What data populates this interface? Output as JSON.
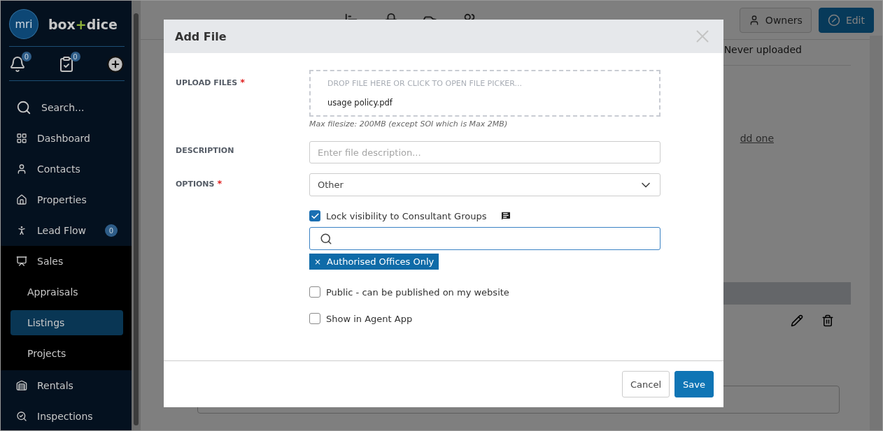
{
  "sidebar": {
    "logo_badge": "mri",
    "logo_parts": [
      "box",
      "+",
      "dice"
    ],
    "counters": [
      {
        "count": "0"
      },
      {
        "count": "0"
      }
    ],
    "items": [
      {
        "label": "Search...",
        "selected": false
      },
      {
        "label": "Dashboard",
        "selected": false
      },
      {
        "label": "Contacts",
        "selected": false
      },
      {
        "label": "Properties",
        "selected": false
      },
      {
        "label": "Lead Flow",
        "badge": "0",
        "selected": false
      },
      {
        "label": "Sales",
        "selected": false,
        "expanded": true,
        "children": [
          {
            "label": "Appraisals",
            "selected": false
          },
          {
            "label": "Listings",
            "selected": true
          },
          {
            "label": "Projects",
            "selected": false
          }
        ]
      },
      {
        "label": "Rentals",
        "selected": false
      },
      {
        "label": "Inspections",
        "selected": false
      }
    ]
  },
  "header": {
    "buttons": [
      {
        "label": "Owners"
      },
      {
        "label": "Edit"
      }
    ]
  },
  "background": {
    "upload_status": "Never uploaded",
    "link": "dd one"
  },
  "dialog": {
    "title": "Add File",
    "upload": {
      "label": "UPLOAD FILES",
      "required_mark": "*",
      "hint": "DROP FILE HERE OR CLICK TO OPEN FILE PICKER...",
      "file": "usage policy.pdf",
      "note": "Max filesize: 200MB (except SOI which is Max 2MB)"
    },
    "description": {
      "label": "DESCRIPTION",
      "placeholder": "Enter file description..."
    },
    "options": {
      "label": "OPTIONS",
      "required_mark": "*",
      "value": "Other"
    },
    "lock": {
      "label": "Lock visibility to Consultant Groups",
      "checked": true,
      "tags": [
        {
          "remove": "×",
          "label": "Authorised Offices Only"
        }
      ]
    },
    "checks": [
      {
        "label": "Public - can be published on my website",
        "checked": false
      },
      {
        "label": "Show in Agent App",
        "checked": false
      }
    ],
    "buttons": [
      {
        "label": "Cancel"
      },
      {
        "label": "Save"
      }
    ]
  }
}
